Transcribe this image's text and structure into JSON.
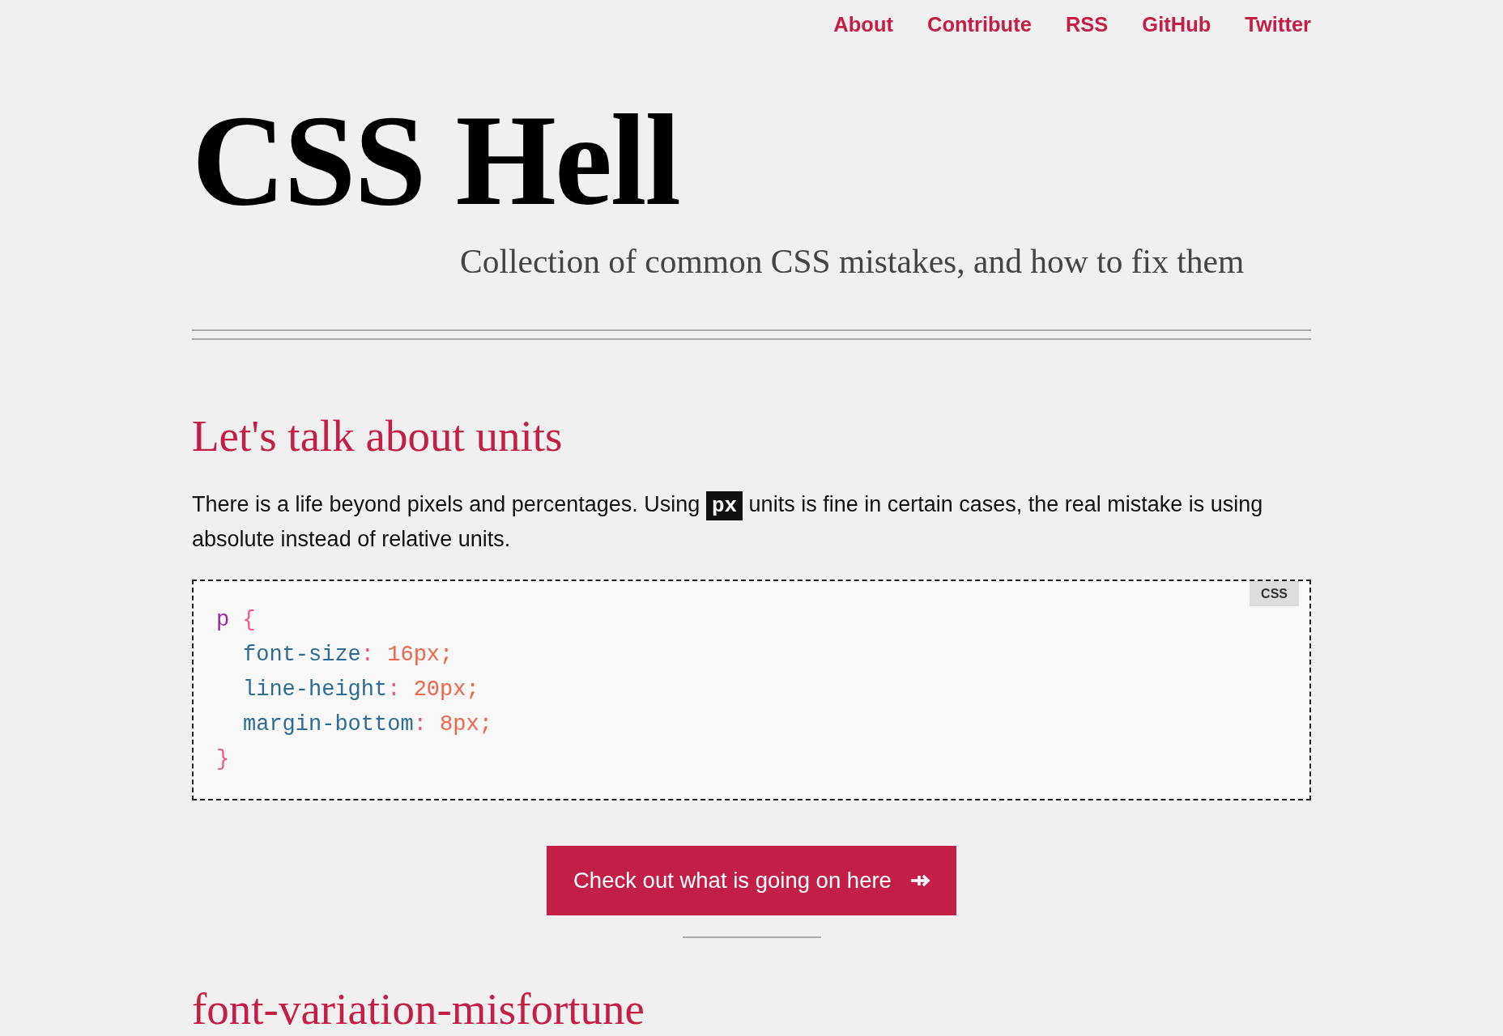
{
  "nav": {
    "links": [
      {
        "label": "About"
      },
      {
        "label": "Contribute"
      },
      {
        "label": "RSS"
      },
      {
        "label": "GitHub"
      },
      {
        "label": "Twitter"
      }
    ]
  },
  "header": {
    "title": "CSS Hell",
    "tagline": "Collection of common CSS mistakes, and how to fix them"
  },
  "sections": [
    {
      "heading": "Let's talk about units",
      "paragraph": [
        {
          "kind": "text",
          "text": "There is a life beyond pixels and percentages. Using "
        },
        {
          "kind": "code",
          "text": "px"
        },
        {
          "kind": "text",
          "text": " units is fine in certain cases, the real mistake is using absolute instead of relative units."
        }
      ],
      "code_block": {
        "language": "CSS",
        "lines": [
          {
            "kind": "open",
            "tokens": [
              {
                "kind": "selector",
                "text": "p"
              },
              {
                "kind": "punctuation",
                "text": " {"
              }
            ]
          },
          {
            "kind": "declaration",
            "tokens": [
              {
                "kind": "property",
                "text": "font-size"
              },
              {
                "kind": "colon",
                "text": ": "
              },
              {
                "kind": "value",
                "text": "16px;"
              }
            ]
          },
          {
            "kind": "declaration",
            "tokens": [
              {
                "kind": "property",
                "text": "line-height"
              },
              {
                "kind": "colon",
                "text": ": "
              },
              {
                "kind": "value",
                "text": "20px;"
              }
            ]
          },
          {
            "kind": "declaration",
            "tokens": [
              {
                "kind": "property",
                "text": "margin-bottom"
              },
              {
                "kind": "colon",
                "text": ": "
              },
              {
                "kind": "value",
                "text": "8px;"
              }
            ]
          },
          {
            "kind": "close",
            "tokens": [
              {
                "kind": "punctuation",
                "text": "}"
              }
            ]
          }
        ]
      },
      "button": {
        "label": "Check out what is going on here"
      }
    },
    {
      "heading": "font-variation-misfortune"
    }
  ]
}
